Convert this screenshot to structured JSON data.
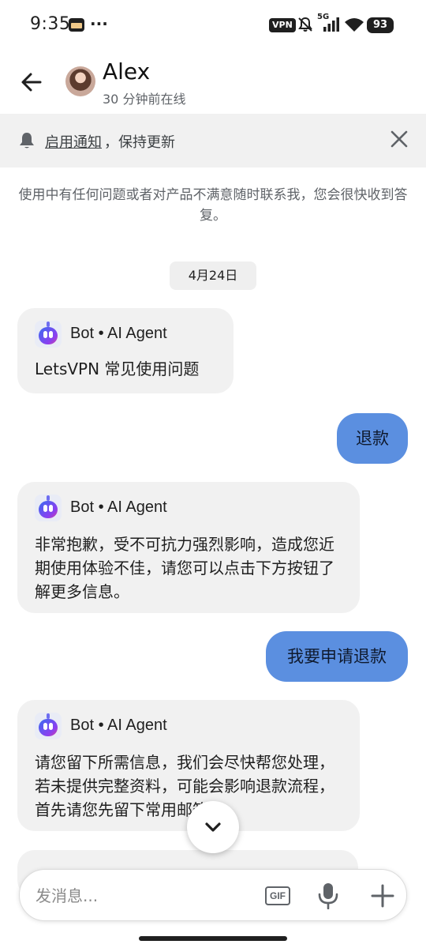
{
  "status_bar": {
    "time": "9:35",
    "dots": "···",
    "vpn_label": "VPN",
    "network_label": "5G",
    "battery": "93"
  },
  "header": {
    "contact_name": "Alex",
    "contact_status": "30 分钟前在线"
  },
  "notification": {
    "link_text": "启用通知",
    "rest_text": "，保持更新"
  },
  "intro_text": "使用中有任何问题或者对产品不满意随时联系我，您会很快收到答复。",
  "date_chip": "4月24日",
  "messages": [
    {
      "sender": "Bot • AI Agent",
      "text": "LetsVPN 常见使用问题"
    },
    {
      "text": "退款"
    },
    {
      "sender": "Bot • AI Agent",
      "text": "非常抱歉，受不可抗力强烈影响，造成您近期使用体验不佳，请您可以点击下方按钮了解更多信息。"
    },
    {
      "text": "我要申请退款"
    },
    {
      "sender": "Bot • AI Agent",
      "text": "请您留下所需信息，我们会尽快帮您处理，若未提供完整资料，可能会影响退款流程，首先请您先留下常用邮箱"
    }
  ],
  "composer": {
    "placeholder": "发消息...",
    "gif_label": "GIF"
  },
  "icons": {
    "back": "arrow-left",
    "bell": "bell",
    "close": "close-x",
    "bot": "bot-robot",
    "scroll_down": "chevron-down",
    "mic": "microphone",
    "plus": "plus"
  }
}
